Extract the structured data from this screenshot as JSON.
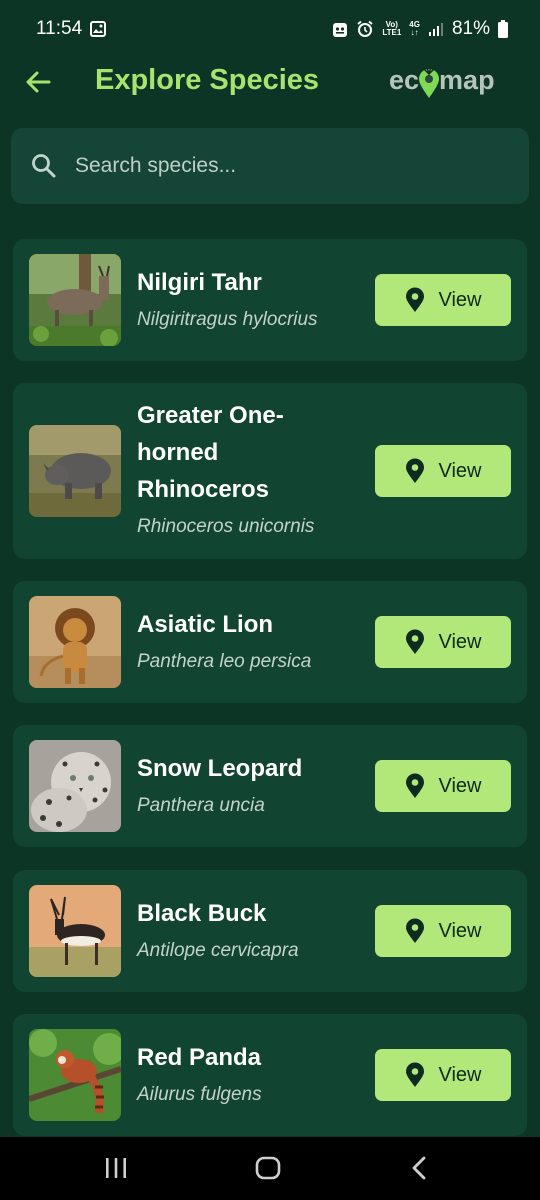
{
  "status_bar": {
    "time": "11:54",
    "network_top": "Vo)",
    "network_bottom": "LTE1",
    "network_type": "4G",
    "battery": "81%"
  },
  "header": {
    "title": "Explore Species",
    "logo_left": "ec",
    "logo_right": "map"
  },
  "search": {
    "placeholder": "Search species..."
  },
  "species": [
    {
      "name": "Nilgiri Tahr",
      "scientific": "Nilgiritragus hylocrius",
      "button": "View"
    },
    {
      "name": "Greater One-horned Rhinoceros",
      "scientific": "Rhinoceros unicornis",
      "button": "View"
    },
    {
      "name": "Asiatic Lion",
      "scientific": "Panthera leo persica",
      "button": "View"
    },
    {
      "name": "Snow Leopard",
      "scientific": "Panthera uncia",
      "button": "View"
    },
    {
      "name": "Black Buck",
      "scientific": "Antilope cervicapra",
      "button": "View"
    },
    {
      "name": "Red Panda",
      "scientific": "Ailurus fulgens",
      "button": "View"
    }
  ],
  "colors": {
    "background": "#0d3526",
    "card": "#124432",
    "accent": "#a7e36f",
    "button": "#b2e77a"
  }
}
